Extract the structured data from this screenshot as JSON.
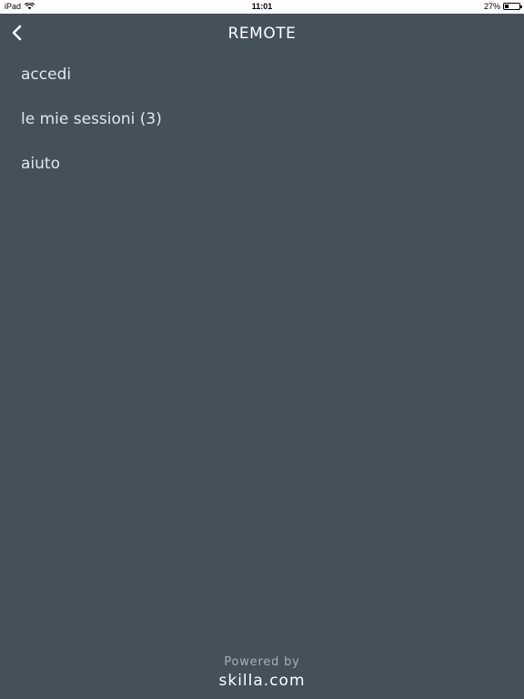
{
  "status_bar": {
    "device": "iPad",
    "time": "11:01",
    "battery_percent": "27%",
    "battery_level": 0.27,
    "wifi_icon": "wifi-icon",
    "battery_icon": "battery-icon"
  },
  "header": {
    "title": "REMOTE",
    "back_icon": "chevron-left-icon"
  },
  "menu": {
    "items": [
      {
        "label": "accedi"
      },
      {
        "label": "le mie sessioni (3)"
      },
      {
        "label": "aiuto"
      }
    ]
  },
  "footer": {
    "powered_by": "Powered by",
    "brand": "skilla.com"
  },
  "colors": {
    "background": "#44505a",
    "text": "#e3e6e8",
    "muted": "#a7b0b7"
  }
}
